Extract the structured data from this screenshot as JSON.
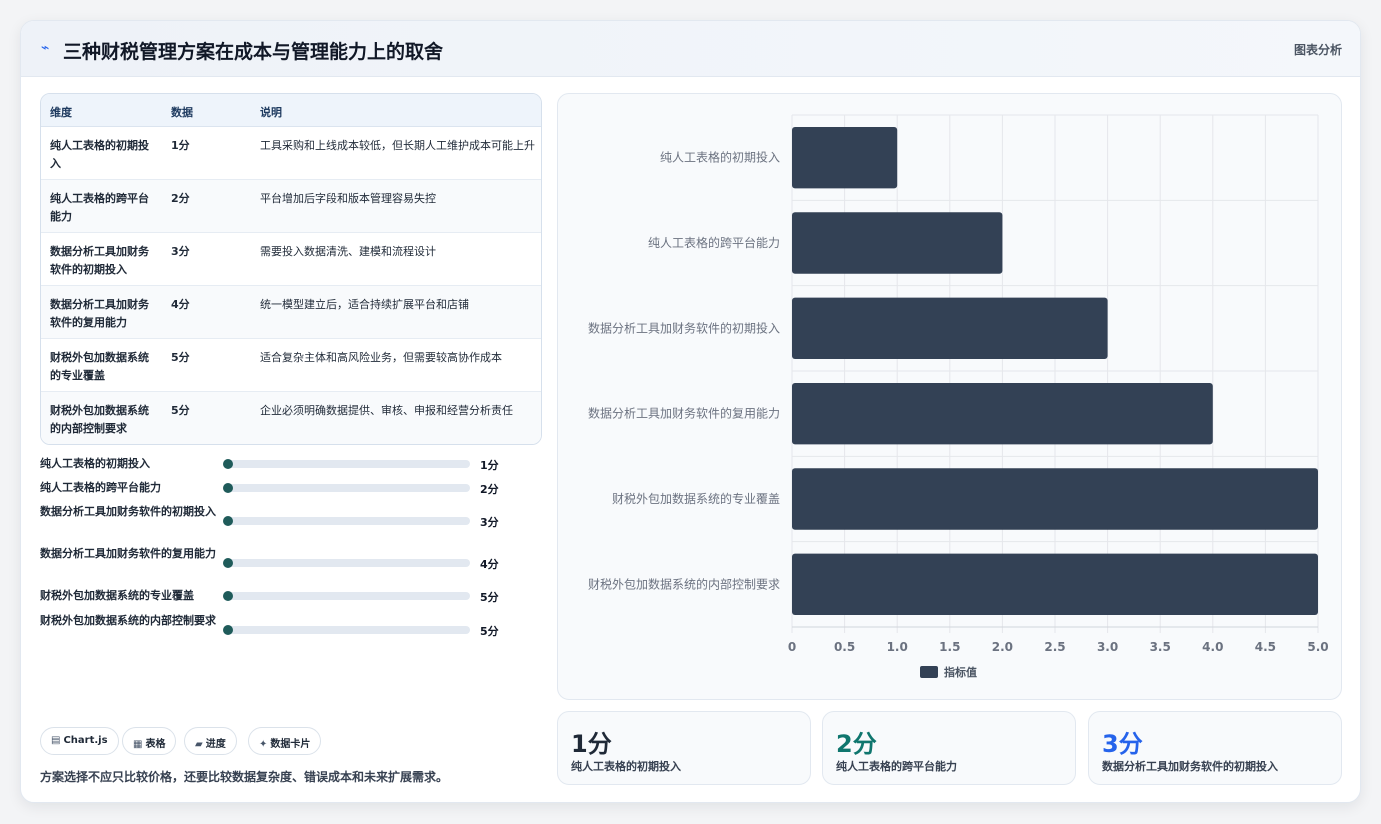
{
  "header": {
    "icon": "lightning-icon",
    "title": "三种财税管理方案在成本与管理能力上的取舍",
    "tag": "图表分析"
  },
  "table": {
    "headers": [
      "维度",
      "数据",
      "说明"
    ],
    "rows": [
      {
        "dim": "纯人工表格的初期投入",
        "val": "1分",
        "desc": "工具采购和上线成本较低，但长期人工维护成本可能上升"
      },
      {
        "dim": "纯人工表格的跨平台能力",
        "val": "2分",
        "desc": "平台增加后字段和版本管理容易失控"
      },
      {
        "dim": "数据分析工具加财务软件的初期投入",
        "val": "3分",
        "desc": "需要投入数据清洗、建模和流程设计"
      },
      {
        "dim": "数据分析工具加财务软件的复用能力",
        "val": "4分",
        "desc": "统一模型建立后，适合持续扩展平台和店铺"
      },
      {
        "dim": "财税外包加数据系统的专业覆盖",
        "val": "5分",
        "desc": "适合复杂主体和高风险业务，但需要较高协作成本"
      },
      {
        "dim": "财税外包加数据系统的内部控制要求",
        "val": "5分",
        "desc": "企业必须明确数据提供、审核、申报和经营分析责任"
      }
    ]
  },
  "progress": [
    {
      "label": "纯人工表格的初期投入",
      "value": "1分",
      "fraction": 0
    },
    {
      "label": "纯人工表格的跨平台能力",
      "value": "2分",
      "fraction": 0
    },
    {
      "label": "数据分析工具加财务软件的初期投入",
      "value": "3分",
      "fraction": 0
    },
    {
      "label": "数据分析工具加财务软件的复用能力",
      "value": "4分",
      "fraction": 0
    },
    {
      "label": "财税外包加数据系统的专业覆盖",
      "value": "5分",
      "fraction": 0
    },
    {
      "label": "财税外包加数据系统的内部控制要求",
      "value": "5分",
      "fraction": 0
    }
  ],
  "chips": [
    {
      "icon": "chart-icon",
      "glyph": "▤",
      "label": "Chart.js"
    },
    {
      "icon": "table-icon",
      "glyph": "▦",
      "label": "表格"
    },
    {
      "icon": "folder-icon",
      "glyph": "▰",
      "label": "进度"
    },
    {
      "icon": "sparkle-icon",
      "glyph": "✦",
      "label": "数据卡片"
    }
  ],
  "footnote": "方案选择不应只比较价格，还要比较数据复杂度、错误成本和未来扩展需求。",
  "stats": [
    {
      "value": "1分",
      "label": "纯人工表格的初期投入",
      "color": "#1f2937"
    },
    {
      "value": "2分",
      "label": "纯人工表格的跨平台能力",
      "color": "#0f766e"
    },
    {
      "value": "3分",
      "label": "数据分析工具加财务软件的初期投入",
      "color": "#2563eb"
    }
  ],
  "chart_data": {
    "type": "bar",
    "orientation": "horizontal",
    "categories": [
      "纯人工表格的初期投入",
      "纯人工表格的跨平台能力",
      "数据分析工具加财务软件的初期投入",
      "数据分析工具加财务软件的复用能力",
      "财税外包加数据系统的专业覆盖",
      "财税外包加数据系统的内部控制要求"
    ],
    "series": [
      {
        "name": "指标值",
        "values": [
          1,
          2,
          3,
          4,
          5,
          5
        ]
      }
    ],
    "xlim": [
      0,
      5
    ],
    "xticks": [
      "0",
      "0.5",
      "1.0",
      "1.5",
      "2.0",
      "2.5",
      "3.0",
      "3.5",
      "4.0",
      "4.5",
      "5.0"
    ],
    "grid": true,
    "legend": "bottom",
    "bar_color": "#334155"
  }
}
